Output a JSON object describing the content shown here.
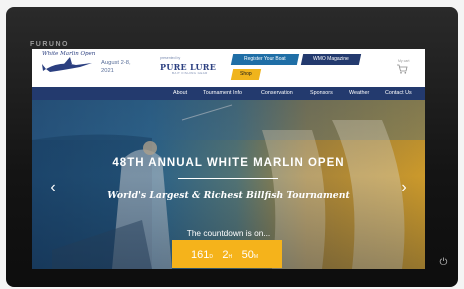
{
  "device": {
    "brand": "FURUNO"
  },
  "header": {
    "logo_text": "White Marlin Open",
    "dates": "August 2-8, 2021",
    "presented_by": "presented by",
    "sponsor_name": "PURE LURE",
    "sponsor_sub": "BAIT FISHING GEAR",
    "register_label": "Register Your Boat",
    "magazine_label": "WMO Magazine",
    "shop_label": "Shop",
    "cart_label": "My cart"
  },
  "nav": {
    "items": [
      {
        "label": "About"
      },
      {
        "label": "Tournament Info"
      },
      {
        "label": "Conservation"
      },
      {
        "label": "Sponsors"
      },
      {
        "label": "Weather"
      },
      {
        "label": "Contact Us"
      }
    ]
  },
  "hero": {
    "headline": "48TH ANNUAL WHITE MARLIN OPEN",
    "tagline": "World's Largest & Richest Billfish Tournament",
    "countdown_label": "The countdown is on...",
    "countdown": {
      "days": "161",
      "days_unit": "D",
      "hours": "2",
      "hours_unit": "H",
      "minutes": "50",
      "minutes_unit": "M"
    },
    "prev_arrow": "‹",
    "next_arrow": "›"
  },
  "colors": {
    "navy": "#233a6e",
    "blue": "#1f6ea6",
    "gold": "#f5b31b"
  }
}
